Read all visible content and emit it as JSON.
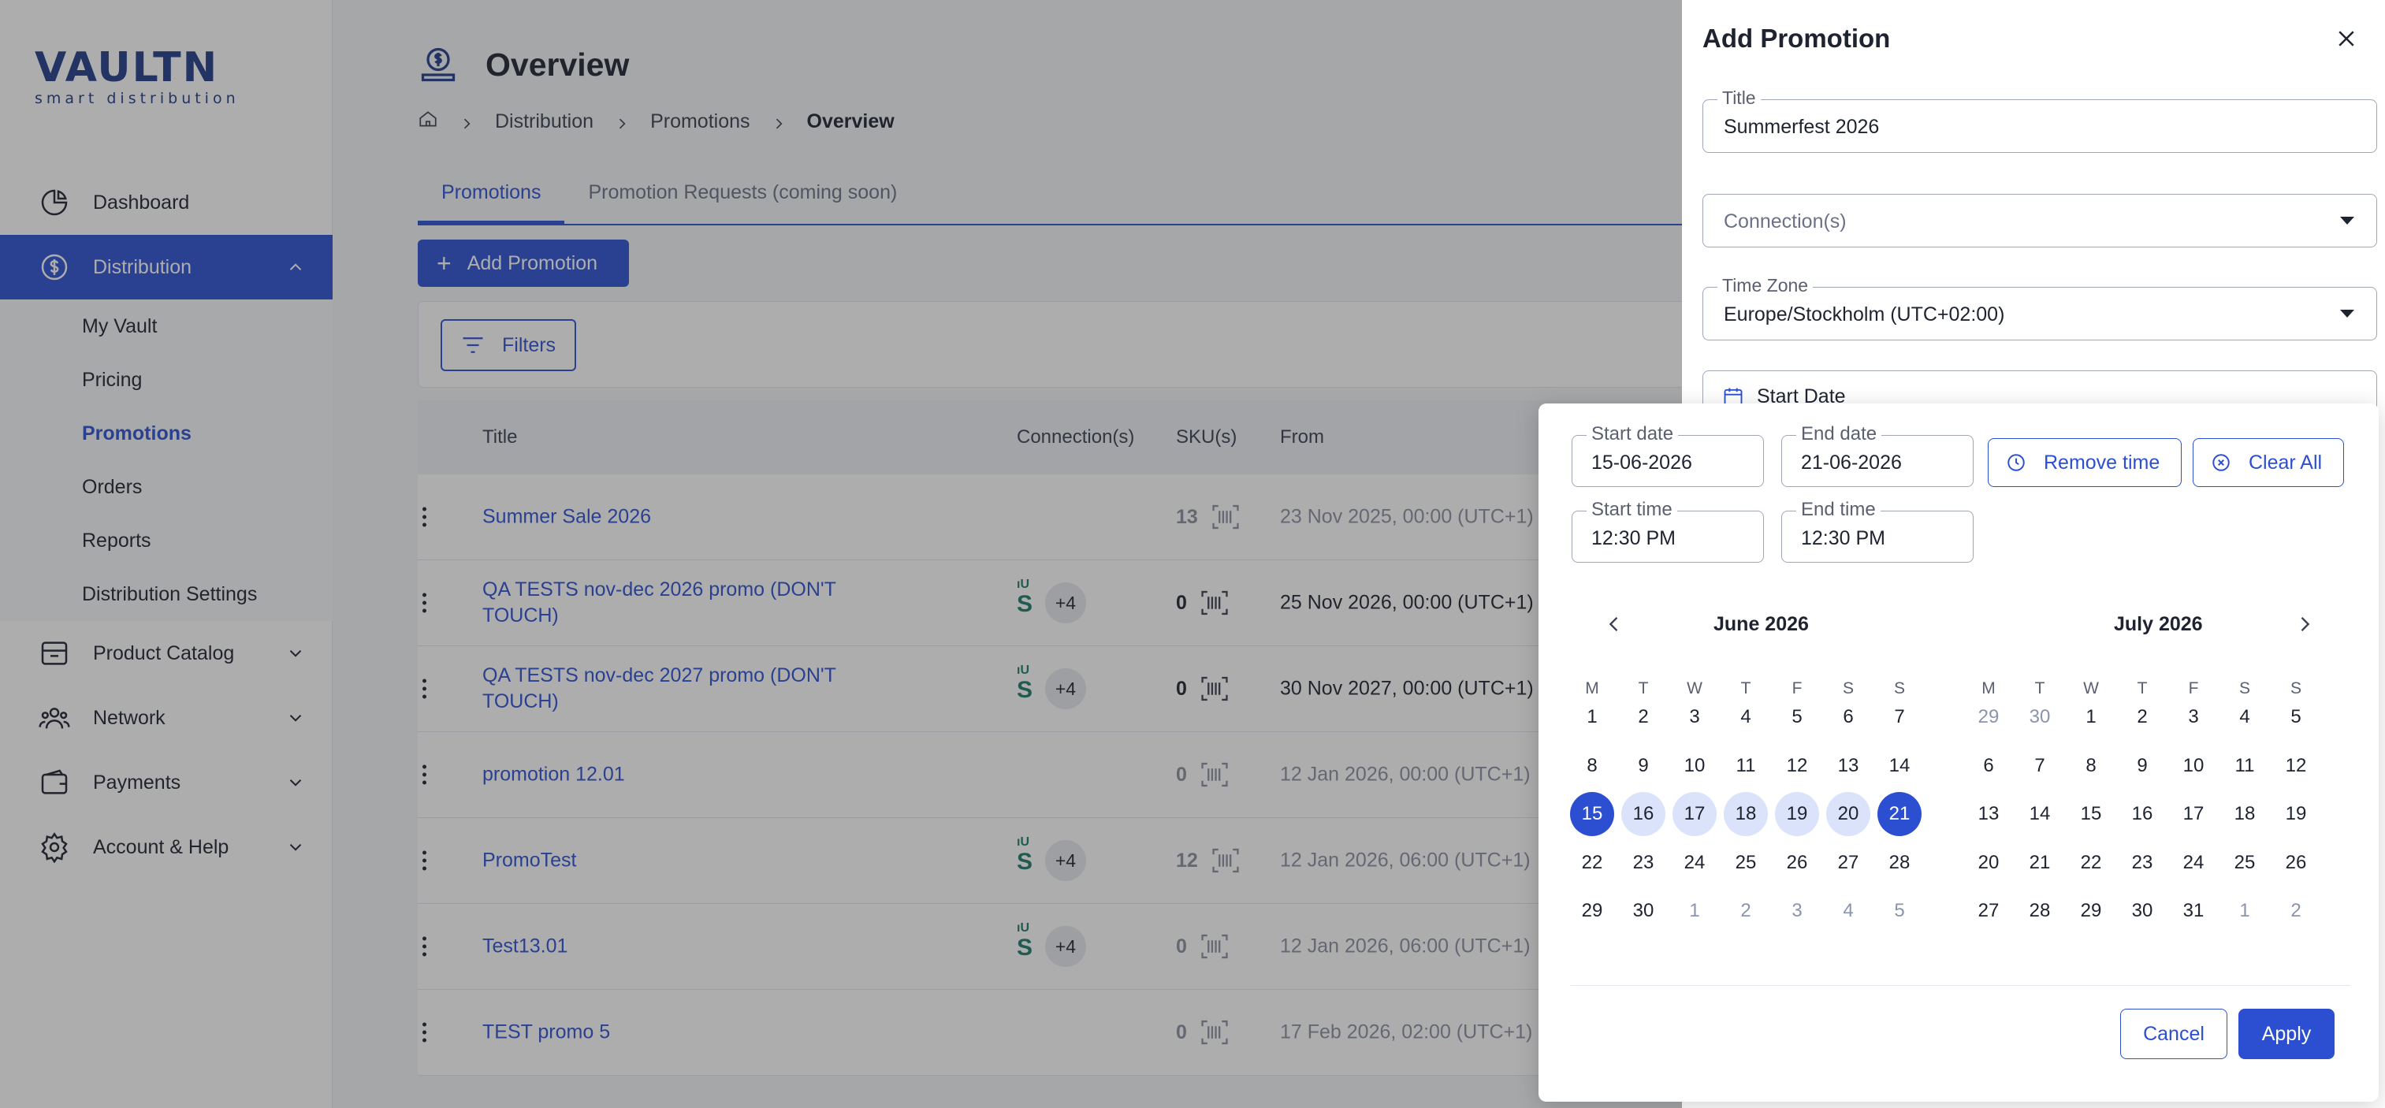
{
  "brand": {
    "name": "VAULTN",
    "tagline": "smart distribution",
    "accent": "#2c4fd1"
  },
  "sidebar": {
    "items": [
      {
        "label": "Dashboard",
        "icon": "pie-chart-icon"
      },
      {
        "label": "Distribution",
        "icon": "dollar-circle-icon"
      },
      {
        "label": "Product Catalog",
        "icon": "box-icon"
      },
      {
        "label": "Network",
        "icon": "users-icon"
      },
      {
        "label": "Payments",
        "icon": "wallet-icon"
      },
      {
        "label": "Account & Help",
        "icon": "gear-icon"
      }
    ],
    "sub_items": [
      {
        "label": "My Vault"
      },
      {
        "label": "Pricing"
      },
      {
        "label": "Promotions"
      },
      {
        "label": "Orders"
      },
      {
        "label": "Reports"
      },
      {
        "label": "Distribution Settings"
      }
    ]
  },
  "page": {
    "title": "Overview",
    "breadcrumb": [
      "Distribution",
      "Promotions",
      "Overview"
    ],
    "tabs": [
      "Promotions",
      "Promotion Requests (coming soon)"
    ],
    "add_label": "Add Promotion",
    "filters_label": "Filters"
  },
  "table": {
    "headers": [
      "Title",
      "Connection(s)",
      "SKU(s)",
      "From"
    ],
    "rows": [
      {
        "title": "Summer Sale 2026",
        "conn": "",
        "sku": "13",
        "from": "23 Nov 2025, 00:00 (UTC+1)"
      },
      {
        "title": "QA TESTS nov-dec 2026 promo (DON'T TOUCH)",
        "conn": "+4",
        "sku": "0",
        "from": "25 Nov 2026, 00:00 (UTC+1)"
      },
      {
        "title": "QA TESTS nov-dec 2027 promo (DON'T TOUCH)",
        "conn": "+4",
        "sku": "0",
        "from": "30 Nov 2027, 00:00 (UTC+1)"
      },
      {
        "title": "promotion 12.01",
        "conn": "",
        "sku": "0",
        "from": "12 Jan 2026, 00:00 (UTC+1)"
      },
      {
        "title": "PromoTest",
        "conn": "+4",
        "sku": "12",
        "from": "12 Jan 2026, 06:00 (UTC+1)"
      },
      {
        "title": "Test13.01",
        "conn": "+4",
        "sku": "0",
        "from": "12 Jan 2026, 06:00 (UTC+1)"
      },
      {
        "title": "TEST promo 5",
        "conn": "",
        "sku": "0",
        "from": "17 Feb 2026, 02:00 (UTC+1)"
      }
    ]
  },
  "drawer": {
    "title": "Add Promotion",
    "title_field": {
      "label": "Title",
      "value": "Summerfest 2026"
    },
    "connections_field": {
      "placeholder": "Connection(s)"
    },
    "timezone_field": {
      "label": "Time Zone",
      "value": "Europe/Stockholm (UTC+02:00)"
    },
    "start_date_placeholder": "Start Date"
  },
  "picker": {
    "start_date": {
      "label": "Start date",
      "value": "15-06-2026"
    },
    "end_date": {
      "label": "End date",
      "value": "21-06-2026"
    },
    "start_time": {
      "label": "Start time",
      "value": "12:30 PM"
    },
    "end_time": {
      "label": "End time",
      "value": "12:30 PM"
    },
    "remove_time_label": "Remove time",
    "clear_all_label": "Clear All",
    "weekdays": [
      "M",
      "T",
      "W",
      "T",
      "F",
      "S",
      "S"
    ],
    "months": [
      {
        "title": "June 2026",
        "weeks": [
          [
            "1",
            "2",
            "3",
            "4",
            "5",
            "6",
            "7"
          ],
          [
            "8",
            "9",
            "10",
            "11",
            "12",
            "13",
            "14"
          ],
          [
            "15",
            "16",
            "17",
            "18",
            "19",
            "20",
            "21"
          ],
          [
            "22",
            "23",
            "24",
            "25",
            "26",
            "27",
            "28"
          ],
          [
            "29",
            "30",
            "1",
            "2",
            "3",
            "4",
            "5"
          ]
        ]
      },
      {
        "title": "July 2026",
        "weeks": [
          [
            "29",
            "30",
            "1",
            "2",
            "3",
            "4",
            "5"
          ],
          [
            "6",
            "7",
            "8",
            "9",
            "10",
            "11",
            "12"
          ],
          [
            "13",
            "14",
            "15",
            "16",
            "17",
            "18",
            "19"
          ],
          [
            "20",
            "21",
            "22",
            "23",
            "24",
            "25",
            "26"
          ],
          [
            "27",
            "28",
            "29",
            "30",
            "31",
            "1",
            "2"
          ]
        ]
      }
    ],
    "cancel_label": "Cancel",
    "apply_label": "Apply"
  }
}
